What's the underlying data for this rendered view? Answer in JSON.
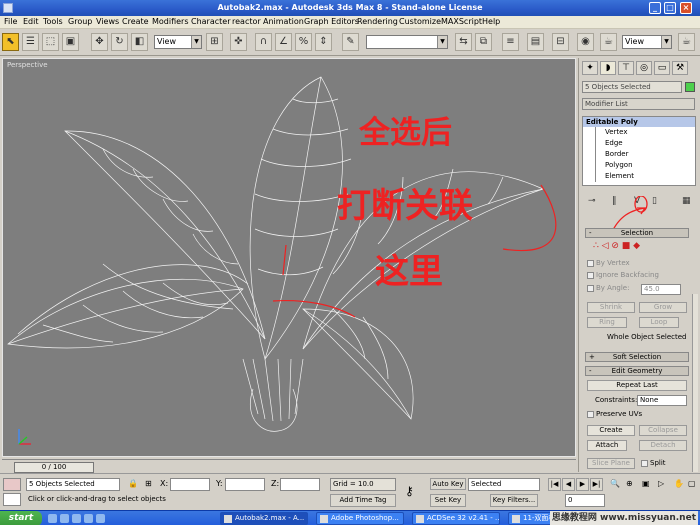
{
  "window": {
    "title": "Autobak2.max - Autodesk 3ds Max 8 - Stand-alone License"
  },
  "menu": [
    "File",
    "Edit",
    "Tools",
    "Group",
    "Views",
    "Create",
    "Modifiers",
    "Character",
    "reactor",
    "Animation",
    "Graph Editors",
    "Rendering",
    "Customize",
    "MAXScript",
    "Help"
  ],
  "toolbar": {
    "ref_coord": "View",
    "render_view": "View"
  },
  "viewport": {
    "label": "Perspective",
    "annotation_lines": [
      "全选后",
      "打断关联",
      "这里"
    ]
  },
  "command_panel": {
    "selection_count": "5 Objects Selected",
    "modifier_list": "Modifier List",
    "stack_header": "Editable Poly",
    "stack_items": [
      "Vertex",
      "Edge",
      "Border",
      "Polygon",
      "Element"
    ],
    "selection_rollout": "Selection",
    "by_vertex": "By Vertex",
    "ignore_backfacing": "Ignore Backfacing",
    "by_angle": "By Angle:",
    "angle_value": "45.0",
    "shrink": "Shrink",
    "grow": "Grow",
    "ring": "Ring",
    "loop": "Loop",
    "whole_selected": "Whole Object Selected",
    "soft_selection": "Soft Selection",
    "edit_geometry": "Edit Geometry",
    "repeat_last": "Repeat Last",
    "constraints_label": "Constraints:",
    "constraints_value": "None",
    "preserve_uvs": "Preserve UVs",
    "create": "Create",
    "collapse": "Collapse",
    "attach": "Attach",
    "detach": "Detach",
    "slice_plane": "Slice Plane",
    "split": "Split"
  },
  "timeline": {
    "slider": "0 / 100"
  },
  "status": {
    "selected": "5 Objects Selected",
    "prompt": "Click or click-and-drag to select objects",
    "x_label": "X:",
    "y_label": "Y:",
    "z_label": "Z:",
    "grid": "Grid = 10.0",
    "add_time_tag": "Add Time Tag",
    "auto_key": "Auto Key",
    "set_key": "Set Key",
    "selected_dropdown": "Selected",
    "key_filters": "Key Filters...",
    "frame": "0"
  },
  "taskbar": {
    "start": "start",
    "tasks": [
      "Autobak2.max - A...",
      "Adobe Photoshop...",
      "ACDSee 32 v2.41 - ...",
      "11-双面材质.jpg - ..."
    ],
    "watermark": "思缘教程网 www.missyuan.net"
  }
}
